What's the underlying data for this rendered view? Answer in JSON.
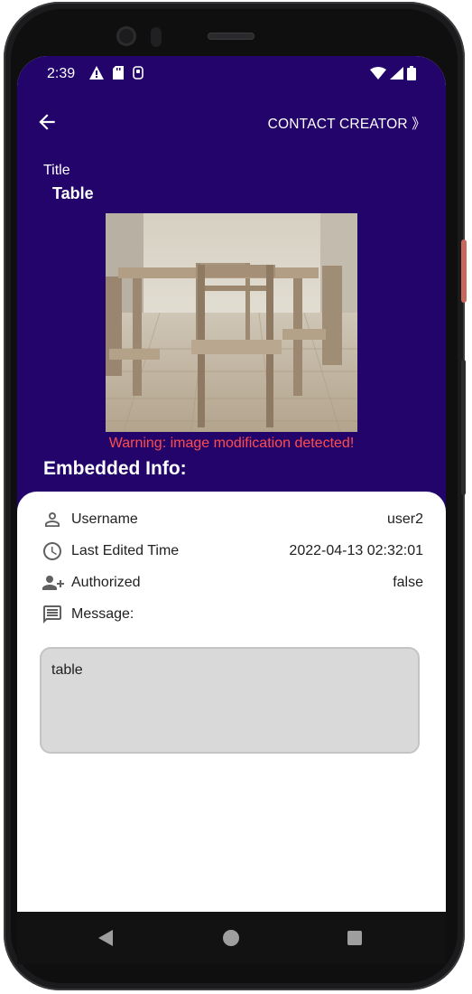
{
  "status": {
    "time": "2:39"
  },
  "appbar": {
    "contact_label": "CONTACT CREATOR 》"
  },
  "content": {
    "title_label": "Title",
    "title_value": "Table",
    "warning": "Warning: image modification detected!",
    "embedded_heading": "Embedded Info:"
  },
  "info": {
    "username_label": "Username",
    "username_value": "user2",
    "edited_label": "Last Edited Time",
    "edited_value": "2022-04-13 02:32:01",
    "authorized_label": "Authorized",
    "authorized_value": "false",
    "message_label": "Message:",
    "message_value": "table"
  },
  "colors": {
    "header_bg": "#22046a",
    "warning": "#ff4d4d",
    "message_bg": "#d9d9d9"
  }
}
